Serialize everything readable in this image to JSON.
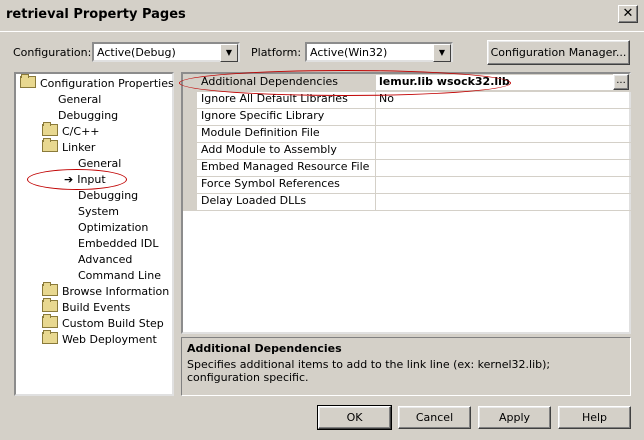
{
  "window": {
    "title": "retrieval Property Pages",
    "close_glyph": "✕"
  },
  "config": {
    "configuration_label": "Configuration:",
    "configuration_value": "Active(Debug)",
    "platform_label": "Platform:",
    "platform_value": "Active(Win32)",
    "manager_button": "Configuration Manager..."
  },
  "tree": {
    "items": [
      {
        "label": "Configuration Properties",
        "icon": "folder-open-icon"
      },
      {
        "label": "General"
      },
      {
        "label": "Debugging"
      },
      {
        "label": "C/C++",
        "icon": "folder-icon"
      },
      {
        "label": "Linker",
        "icon": "folder-open-icon"
      },
      {
        "label": "General"
      },
      {
        "label": "Input",
        "icon": "arrow-icon",
        "selected": true
      },
      {
        "label": "Debugging"
      },
      {
        "label": "System"
      },
      {
        "label": "Optimization"
      },
      {
        "label": "Embedded IDL"
      },
      {
        "label": "Advanced"
      },
      {
        "label": "Command Line"
      },
      {
        "label": "Browse Information",
        "icon": "folder-icon"
      },
      {
        "label": "Build Events",
        "icon": "folder-icon"
      },
      {
        "label": "Custom Build Step",
        "icon": "folder-icon"
      },
      {
        "label": "Web Deployment",
        "icon": "folder-icon"
      }
    ]
  },
  "grid": {
    "rows": [
      {
        "name": "Additional Dependencies",
        "value": "lemur.lib wsock32.lib",
        "selected": true
      },
      {
        "name": "Ignore All Default Libraries",
        "value": "No"
      },
      {
        "name": "Ignore Specific Library",
        "value": ""
      },
      {
        "name": "Module Definition File",
        "value": ""
      },
      {
        "name": "Add Module to Assembly",
        "value": ""
      },
      {
        "name": "Embed Managed Resource File",
        "value": ""
      },
      {
        "name": "Force Symbol References",
        "value": ""
      },
      {
        "name": "Delay Loaded DLLs",
        "value": ""
      }
    ],
    "browse_button": "..."
  },
  "description": {
    "title": "Additional Dependencies",
    "text": "Specifies additional items to add to the link line (ex: kernel32.lib); configuration specific."
  },
  "buttons": {
    "ok": "OK",
    "cancel": "Cancel",
    "apply": "Apply",
    "help": "Help"
  },
  "colors": {
    "annotation": "#c00000",
    "selection": "#d4d0c8"
  }
}
